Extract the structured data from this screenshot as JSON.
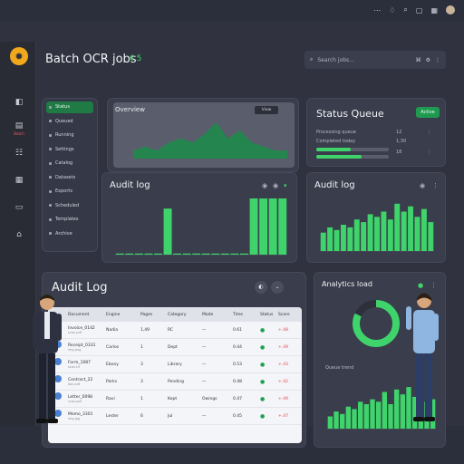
{
  "topbar": {
    "icons": [
      "dots-icon",
      "bell-icon",
      "search-icon",
      "window-icon",
      "grid-icon"
    ]
  },
  "app": {
    "title": "Batch OCR jobs",
    "badge": "4 5"
  },
  "search": {
    "placeholder": "Search jobs…",
    "shortcut": "⌘"
  },
  "rail": {
    "items": [
      {
        "icon": "◧",
        "label": ""
      },
      {
        "icon": "▤",
        "label": "Batch"
      },
      {
        "icon": "☷",
        "label": ""
      },
      {
        "icon": "▦",
        "label": ""
      },
      {
        "icon": "▭",
        "label": ""
      },
      {
        "icon": "⌂",
        "label": ""
      }
    ]
  },
  "sidebar": {
    "items": [
      {
        "label": "Status"
      },
      {
        "label": "Queued"
      },
      {
        "label": "Running"
      },
      {
        "label": "Settings"
      },
      {
        "label": "Catalog"
      },
      {
        "label": "Datasets"
      },
      {
        "label": "Exports"
      },
      {
        "label": "Scheduled"
      },
      {
        "label": "Templates"
      },
      {
        "label": "Archive"
      }
    ]
  },
  "overview_panel": {
    "label": "Overview",
    "button": "View"
  },
  "status_panel": {
    "title": "Status Queue",
    "pill": "Active",
    "rows": [
      {
        "label": "Processing queue",
        "value": "12"
      },
      {
        "label": "Completed today",
        "value": "1,30"
      }
    ],
    "bars": [
      {
        "fill": 0.48
      },
      {
        "fill": 0.62
      }
    ],
    "extra": "18"
  },
  "audit_panel_small": {
    "title": "Audit log"
  },
  "audit_panel_right": {
    "title": "Audit log"
  },
  "table_panel": {
    "title": "Audit Log",
    "headers": [
      "Document",
      "Engine",
      "Pages",
      "Category",
      "Mode",
      "Time",
      "Status",
      "Score"
    ],
    "rows": [
      {
        "doc": "Invoice_0142",
        "sub": "scan.pdf",
        "engine": "Nadia",
        "pages": "1,49",
        "cat": "RC",
        "mode": "—",
        "time": "0.61",
        "status": "●",
        "score": "+.48"
      },
      {
        "doc": "Receipt_0331",
        "sub": "img.png",
        "engine": "Carlos",
        "pages": "1",
        "cat": "Dept",
        "mode": "—",
        "time": "0.44",
        "status": "●",
        "score": "+.49"
      },
      {
        "doc": "Form_1087",
        "sub": "scan.tif",
        "engine": "Ebony",
        "pages": "3",
        "cat": "Library",
        "mode": "—",
        "time": "0.53",
        "status": "●",
        "score": "+.43"
      },
      {
        "doc": "Contract_22",
        "sub": "doc.pdf",
        "engine": "Parks",
        "pages": "3",
        "cat": "Pending",
        "mode": "—",
        "time": "0.48",
        "status": "●",
        "score": "+.42"
      },
      {
        "doc": "Letter_0098",
        "sub": "scan.pdf",
        "engine": "Ravi",
        "pages": "1",
        "cat": "Kept",
        "mode": "Owings",
        "time": "0.47",
        "status": "●",
        "score": "+.49"
      },
      {
        "doc": "Memo_3301",
        "sub": "img.jpg",
        "engine": "Lester",
        "pages": "6",
        "cat": "Jul",
        "mode": "—",
        "time": "0.45",
        "status": "●",
        "score": "+.47"
      }
    ]
  },
  "analytics_panel": {
    "title": "Analytics load",
    "legend": "Queue trend",
    "donut_fill": 0.82
  },
  "colors": {
    "accent": "#3fd46b",
    "panel": "#3a3d4b",
    "bg": "#30333f"
  },
  "chart_data": [
    {
      "type": "area",
      "values": [
        2,
        3,
        2,
        4,
        5,
        4,
        6,
        9,
        5,
        7,
        4,
        3,
        2,
        2
      ]
    },
    {
      "type": "bar",
      "values": [
        0.02,
        0.02,
        0.02,
        0.02,
        0.02,
        0.82,
        0.02,
        0.02,
        0.02,
        0.02,
        0.02,
        0.02,
        0.02,
        0.02,
        1.0,
        1.0,
        1.0,
        1.0
      ]
    },
    {
      "type": "bar",
      "values": [
        0.35,
        0.45,
        0.4,
        0.5,
        0.45,
        0.6,
        0.55,
        0.7,
        0.65,
        0.75,
        0.6,
        0.9,
        0.75,
        0.85,
        0.65,
        0.8,
        0.55
      ]
    },
    {
      "type": "bar",
      "values": [
        0.25,
        0.35,
        0.3,
        0.45,
        0.4,
        0.55,
        0.5,
        0.6,
        0.55,
        0.75,
        0.5,
        0.8,
        0.7,
        0.85,
        0.65,
        0.7,
        0.55,
        0.6
      ]
    }
  ]
}
